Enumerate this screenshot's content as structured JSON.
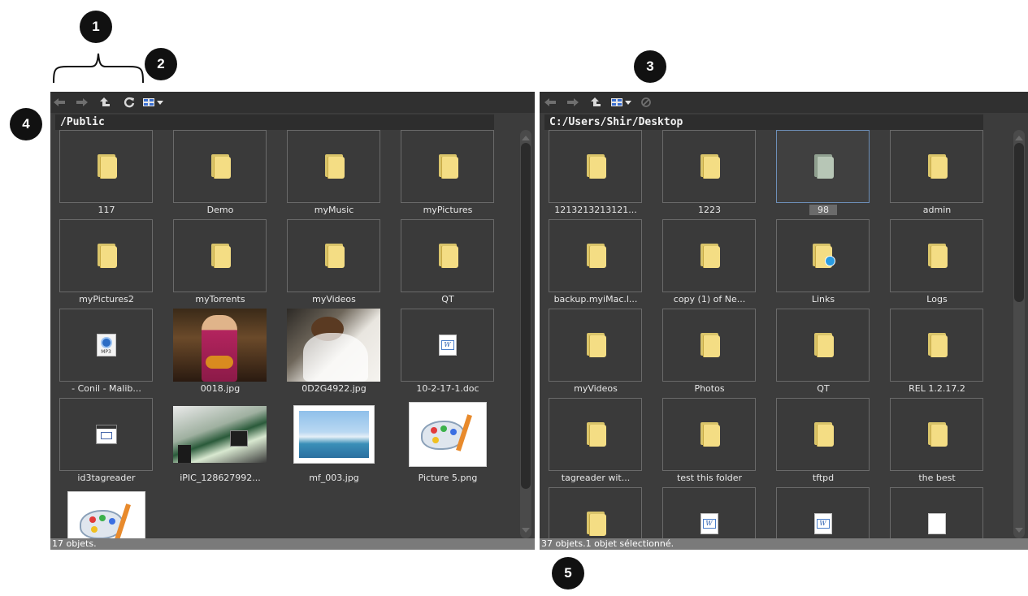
{
  "callouts": [
    "1",
    "2",
    "3",
    "4",
    "5"
  ],
  "left_pane": {
    "path": "/Public",
    "status": "17 objets.",
    "items": [
      {
        "label": "117",
        "icon": "folder-icon"
      },
      {
        "label": "Demo",
        "icon": "folder-icon"
      },
      {
        "label": "myMusic",
        "icon": "folder-icon"
      },
      {
        "label": "myPictures",
        "icon": "folder-icon"
      },
      {
        "label": "myPictures2",
        "icon": "folder-icon"
      },
      {
        "label": "myTorrents",
        "icon": "folder-icon"
      },
      {
        "label": "myVideos",
        "icon": "folder-icon"
      },
      {
        "label": "QT",
        "icon": "folder-icon"
      },
      {
        "label": "- Conil - Malib...",
        "icon": "mp3-file-icon"
      },
      {
        "label": "0018.jpg",
        "icon": "photo-thumbnail"
      },
      {
        "label": "0D2G4922.jpg",
        "icon": "photo-thumbnail"
      },
      {
        "label": "10-2-17-1.doc",
        "icon": "word-document-icon"
      },
      {
        "label": "id3tagreader",
        "icon": "application-icon"
      },
      {
        "label": "iPIC_128627992...",
        "icon": "photo-thumbnail"
      },
      {
        "label": "mf_003.jpg",
        "icon": "photo-thumbnail"
      },
      {
        "label": "Picture 5.png",
        "icon": "palette-image-icon"
      },
      {
        "label": "",
        "icon": "palette-image-icon"
      }
    ]
  },
  "right_pane": {
    "path": "C:/Users/Shir/Desktop",
    "status": "37 objets.1 objet sélectionné.",
    "items": [
      {
        "label": "1213213213121...",
        "icon": "folder-icon"
      },
      {
        "label": "1223",
        "icon": "folder-icon"
      },
      {
        "label": "98",
        "icon": "folder-icon",
        "selected": true
      },
      {
        "label": "admin",
        "icon": "folder-icon"
      },
      {
        "label": "backup.myiMac.l...",
        "icon": "folder-icon"
      },
      {
        "label": "copy (1) of Ne...",
        "icon": "folder-icon"
      },
      {
        "label": "Links",
        "icon": "links-folder-icon"
      },
      {
        "label": "Logs",
        "icon": "folder-icon"
      },
      {
        "label": "myVideos",
        "icon": "folder-icon"
      },
      {
        "label": "Photos",
        "icon": "folder-icon"
      },
      {
        "label": "QT",
        "icon": "folder-icon"
      },
      {
        "label": "REL 1.2.17.2",
        "icon": "folder-icon"
      },
      {
        "label": "tagreader wit...",
        "icon": "folder-icon"
      },
      {
        "label": "test this folder",
        "icon": "folder-icon"
      },
      {
        "label": "tftpd",
        "icon": "folder-icon"
      },
      {
        "label": "the best",
        "icon": "folder-icon"
      },
      {
        "label": "",
        "icon": "folder-icon"
      },
      {
        "label": "",
        "icon": "word-document-icon"
      },
      {
        "label": "",
        "icon": "word-document-icon"
      },
      {
        "label": "",
        "icon": "blank-document-icon"
      }
    ]
  },
  "toolbar": {
    "left": [
      "back-arrow-icon",
      "forward-arrow-icon",
      "up-folder-icon",
      "refresh-icon",
      "view-mode-icon"
    ],
    "right": [
      "back-arrow-icon",
      "forward-arrow-icon",
      "up-folder-icon",
      "view-mode-icon",
      "hide-icon"
    ]
  },
  "colors": {
    "pane_bg": "#3c3c3c",
    "toolbar_bg": "#303030",
    "status_bg": "#7a7a7a",
    "folder": "#f4dd84",
    "selection_border": "#6d8fb8"
  }
}
